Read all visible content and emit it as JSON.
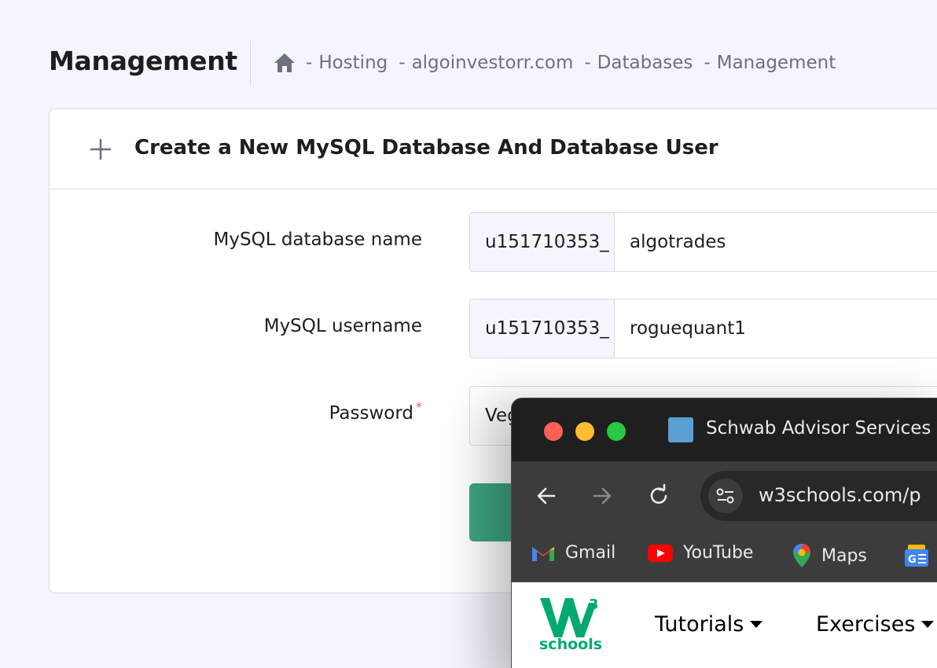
{
  "header": {
    "title": "Management",
    "breadcrumb": [
      "Hosting",
      "algoinvestorr.com",
      "Databases",
      "Management"
    ],
    "separator": "-"
  },
  "card": {
    "title": "Create a New MySQL Database And Database User",
    "fields": [
      {
        "label": "MySQL database name",
        "prefix": "u151710353_",
        "value": "algotrades"
      },
      {
        "label": "MySQL username",
        "prefix": "u151710353_",
        "value": "roguequant1"
      },
      {
        "label": "Password",
        "required_mark": "*",
        "value": "Veg"
      }
    ],
    "button_visible_fragment": "",
    "accent_color": "#3fa580"
  },
  "chrome": {
    "tab_title": "Schwab Advisor Services i",
    "url": "w3schools.com/p",
    "bookmarks": [
      {
        "label": "Gmail",
        "icon": "gmail-icon"
      },
      {
        "label": "YouTube",
        "icon": "youtube-icon"
      },
      {
        "label": "Maps",
        "icon": "maps-icon"
      },
      {
        "label": "",
        "icon": "google-news-icon"
      }
    ],
    "page": {
      "logo_text": "schools",
      "logo_sup": "3",
      "nav": [
        "Tutorials",
        "Exercises"
      ]
    }
  }
}
